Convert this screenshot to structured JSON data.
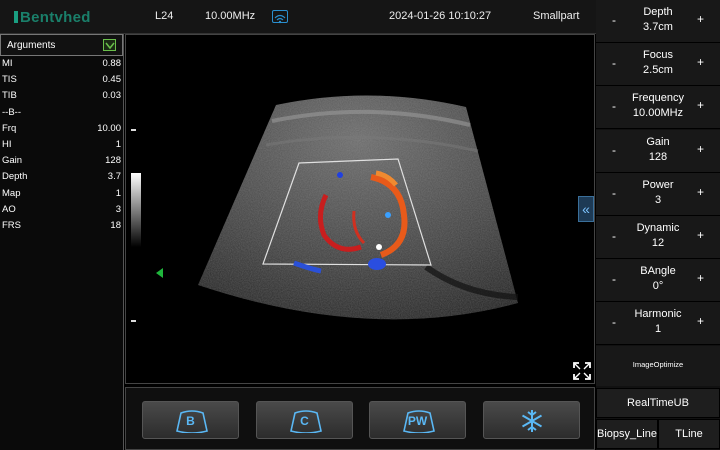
{
  "header": {
    "logo": "Bentvhed",
    "probe": "L24",
    "frequency": "10.00MHz",
    "datetime": "2024-01-26 10:10:27",
    "preset": "Smallpart"
  },
  "arguments": {
    "title": "Arguments",
    "items": [
      {
        "k": "MI",
        "v": "0.88"
      },
      {
        "k": "TIS",
        "v": "0.45"
      },
      {
        "k": "TIB",
        "v": "0.03"
      },
      {
        "k": "--B--",
        "v": ""
      },
      {
        "k": "Frq",
        "v": "10.00"
      },
      {
        "k": "HI",
        "v": "1"
      },
      {
        "k": "Gain",
        "v": "128"
      },
      {
        "k": "Depth",
        "v": "3.7"
      },
      {
        "k": "Map",
        "v": "1"
      },
      {
        "k": "AO",
        "v": "3"
      },
      {
        "k": "FRS",
        "v": "18"
      }
    ]
  },
  "controls": [
    {
      "name": "Depth",
      "value": "3.7cm",
      "minus": "-",
      "plus": "+"
    },
    {
      "name": "Focus",
      "value": "2.5cm",
      "minus": "-",
      "plus": "+"
    },
    {
      "name": "Frequency",
      "value": "10.00MHz",
      "minus": "-",
      "plus": "+"
    },
    {
      "name": "Gain",
      "value": "128",
      "minus": "-",
      "plus": "+"
    },
    {
      "name": "Power",
      "value": "3",
      "minus": "-",
      "plus": "+"
    },
    {
      "name": "Dynamic",
      "value": "12",
      "minus": "-",
      "plus": "+"
    },
    {
      "name": "BAngle",
      "value": "0°",
      "minus": "-",
      "plus": "+"
    },
    {
      "name": "Harmonic",
      "value": "1",
      "minus": "-",
      "plus": "+"
    }
  ],
  "image_optimize": "ImageOptimize",
  "buttons": {
    "realtime": "RealTimeUB",
    "biopsy": "Biopsy_Line",
    "tline": "TLine"
  },
  "modes": {
    "b": "B",
    "c": "C",
    "pw": "PW"
  },
  "icons": {
    "collapse": "«"
  },
  "colors": {
    "accent": "#5ab8f5",
    "focus_marker": "#1fb63c",
    "logo": "#1a7f6a"
  }
}
